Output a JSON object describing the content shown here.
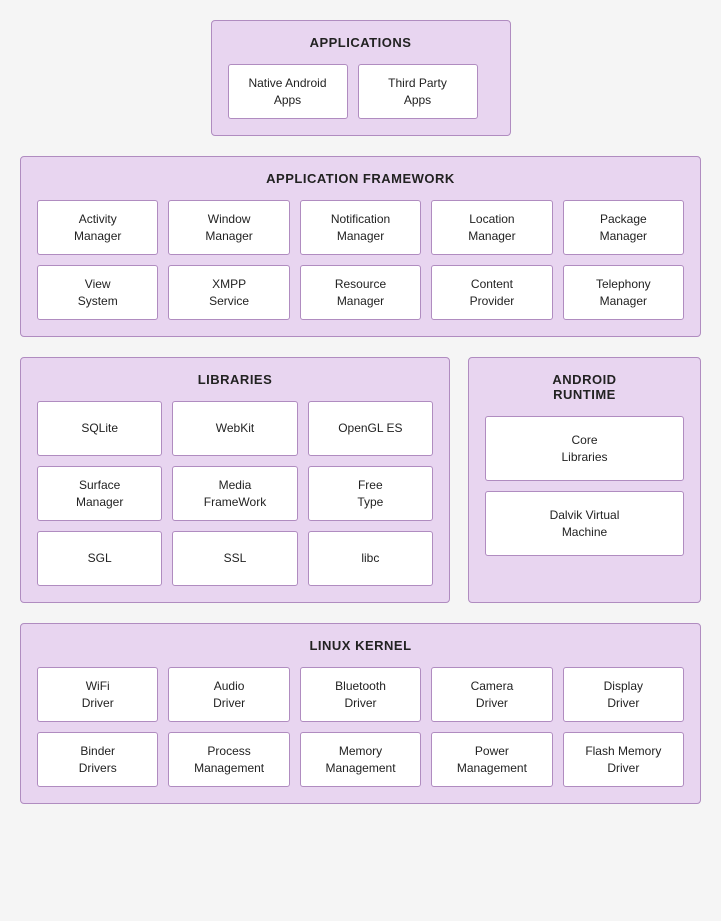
{
  "applications": {
    "title": "APPLICATIONS",
    "items": [
      "Native Android\nApps",
      "Third Party\nApps"
    ]
  },
  "appframework": {
    "title": "APPLICATION FRAMEWORK",
    "row1": [
      "Activity\nManager",
      "Window\nManager",
      "Notification\nManager",
      "Location\nManager",
      "Package\nManager"
    ],
    "row2": [
      "View\nSystem",
      "XMPP\nService",
      "Resource\nManager",
      "Content\nProvider",
      "Telephony\nManager"
    ]
  },
  "libraries": {
    "title": "LIBRARIES",
    "row1": [
      "SQLite",
      "WebKit",
      "OpenGL ES"
    ],
    "row2": [
      "Surface\nManager",
      "Media\nFrameWork",
      "Free\nType"
    ],
    "row3": [
      "SGL",
      "SSL",
      "libc"
    ]
  },
  "androidruntime": {
    "title": "ANDROID\nRUNTIME",
    "items": [
      "Core\nLibraries",
      "Dalvik Virtual\nMachine"
    ]
  },
  "linuxkernel": {
    "title": "LINUX KERNEL",
    "row1": [
      "WiFi\nDriver",
      "Audio\nDriver",
      "Bluetooth\nDriver",
      "Camera\nDriver",
      "Display\nDriver"
    ],
    "row2": [
      "Binder\nDrivers",
      "Process\nManagement",
      "Memory\nManagement",
      "Power\nManagement",
      "Flash Memory\nDriver"
    ]
  }
}
